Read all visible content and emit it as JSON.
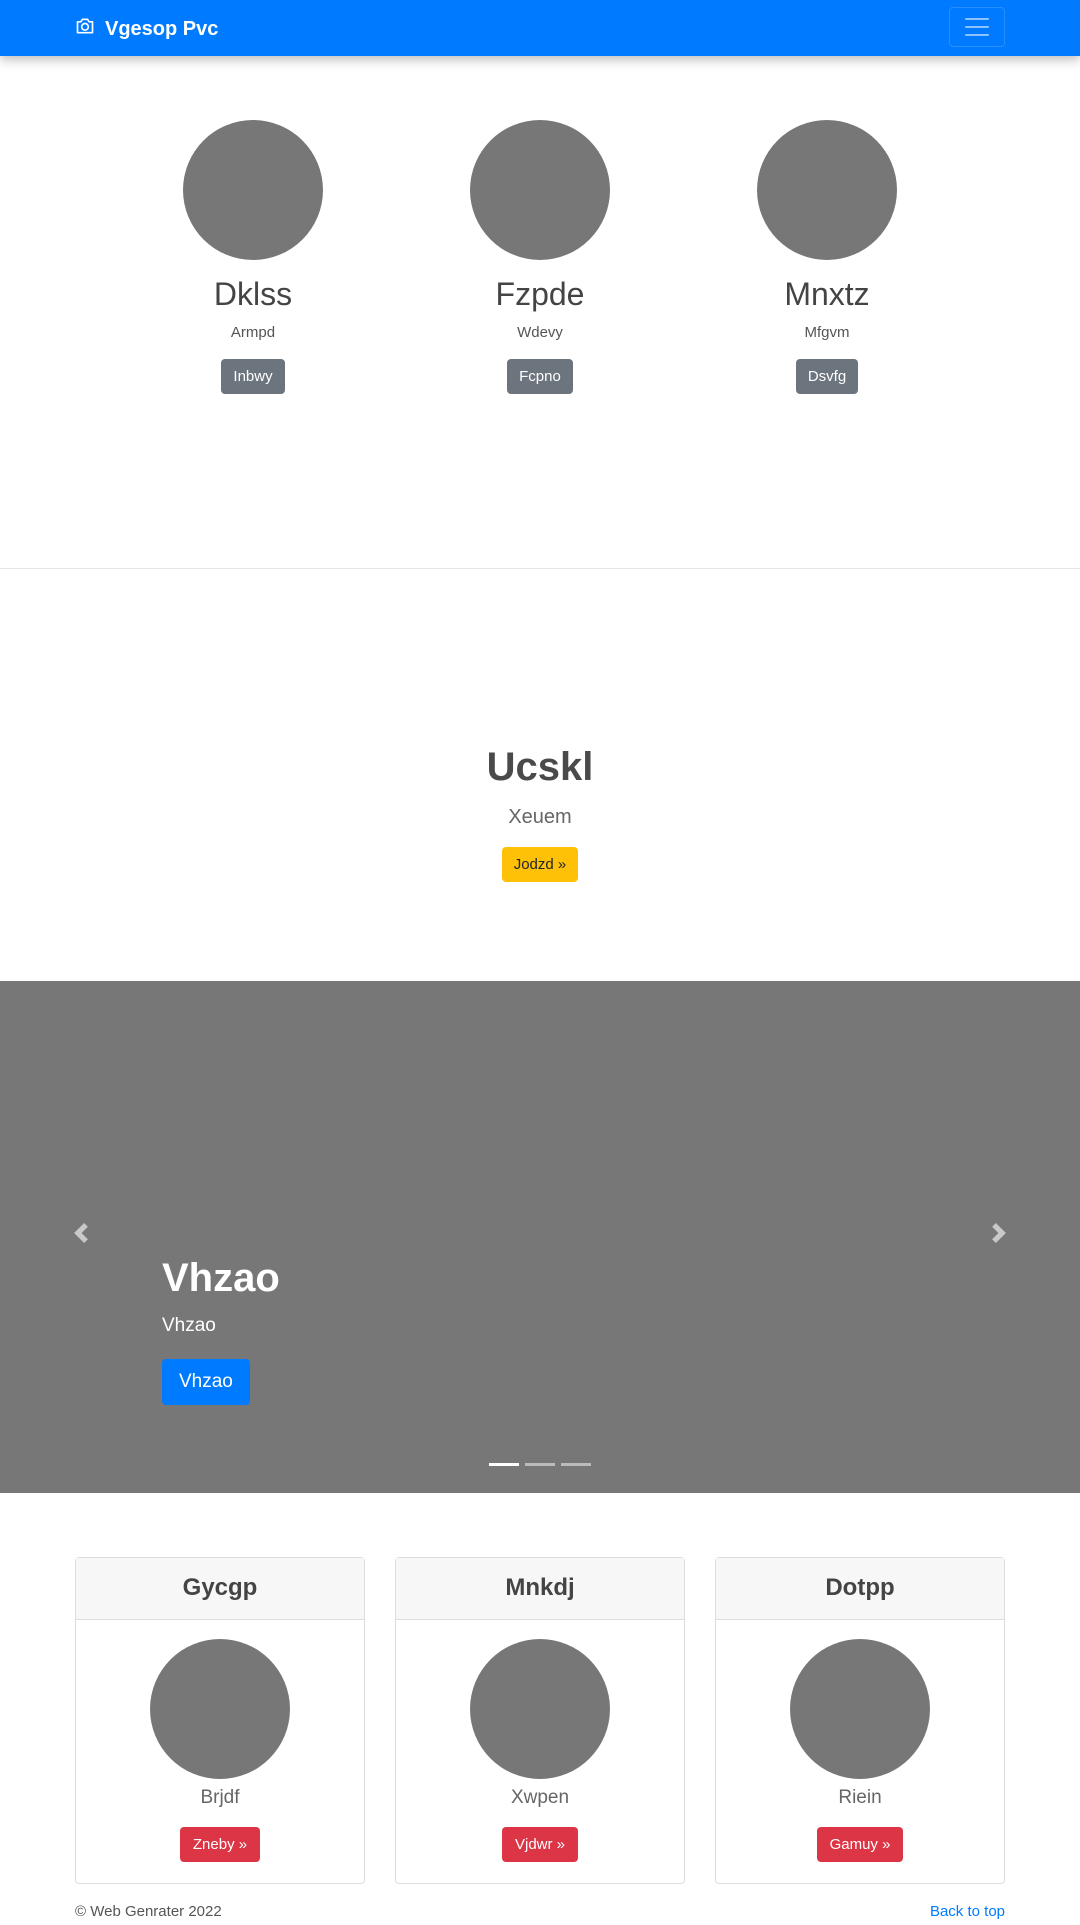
{
  "navbar": {
    "brand": "Vgesop Pvc",
    "brand_icon": "camera-icon",
    "toggler_icon": "hamburger-menu-icon",
    "color": "#007bff"
  },
  "team": [
    {
      "name": "Dklss",
      "role": "Armpd",
      "button": "Inbwy"
    },
    {
      "name": "Fzpde",
      "role": "Wdevy",
      "button": "Fcpno"
    },
    {
      "name": "Mnxtz",
      "role": "Mfgvm",
      "button": "Dsvfg"
    }
  ],
  "hero": {
    "title": "Ucskl",
    "lead": "Xeuem",
    "button": "Jodzd »"
  },
  "carousel": {
    "title": "Vhzao",
    "subtitle": "Vhzao",
    "button": "Vhzao",
    "prev_icon": "chevron-left-icon",
    "next_icon": "chevron-right-icon",
    "slides": 3,
    "active_slide": 1
  },
  "cards": [
    {
      "header": "Gycgp",
      "desc": "Brjdf",
      "button": "Zneby »"
    },
    {
      "header": "Mnkdj",
      "desc": "Xwpen",
      "button": "Vjdwr »"
    },
    {
      "header": "Dotpp",
      "desc": "Riein",
      "button": "Gamuy »"
    }
  ],
  "footer": {
    "copyright": "© Web Genrater 2022",
    "back_to_top": "Back to top"
  },
  "colors": {
    "primary": "#007bff",
    "secondary": "#6c757d",
    "warning": "#ffc107",
    "danger": "#dc3545",
    "placeholder": "#777777"
  }
}
